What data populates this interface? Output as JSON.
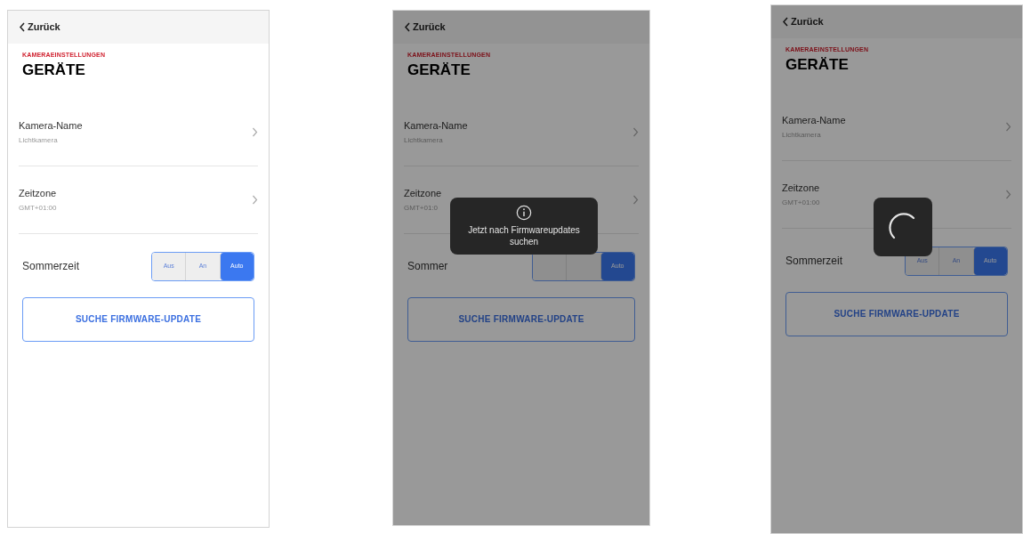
{
  "screens": [
    {
      "back": "Zurück",
      "overline": "KAMERAEINSTELLUNGEN",
      "title": "GERÄTE",
      "rows": [
        {
          "label": "Kamera-Name",
          "value": "Lichtkamera"
        },
        {
          "label": "Zeitzone",
          "value": "GMT+01:00"
        }
      ],
      "toggle": {
        "label": "Sommerzeit",
        "options": [
          {
            "label": "Aus",
            "selected": false
          },
          {
            "label": "An",
            "selected": false
          },
          {
            "label": "Auto",
            "selected": true
          }
        ]
      },
      "button": "SUCHE FIRMWARE-UPDATE",
      "dimmed": false
    },
    {
      "back": "Zurück",
      "overline": "KAMERAEINSTELLUNGEN",
      "title": "GERÄTE",
      "rows": [
        {
          "label": "Kamera-Name",
          "value": "Lichtkamera"
        },
        {
          "label": "Zeitzone",
          "value": "GMT+01:0"
        }
      ],
      "toggle": {
        "label": "Sommer",
        "options": [
          {
            "selected": false
          },
          {
            "selected": false
          },
          {
            "label": "Auto",
            "selected": true
          }
        ]
      },
      "button": "SUCHE FIRMWARE-UPDATE",
      "dimmed": true,
      "overlay": {
        "kind": "toast",
        "message": "Jetzt nach Firmwareupdates suchen"
      }
    },
    {
      "back": "Zurück",
      "overline": "KAMERAEINSTELLUNGEN",
      "title": "GERÄTE",
      "rows": [
        {
          "label": "Kamera-Name",
          "value": "Lichtkamera"
        },
        {
          "label": "Zeitzone",
          "value": "GMT+01:00"
        }
      ],
      "toggle": {
        "label": "Sommerzeit",
        "options": [
          {
            "label": "Aus",
            "selected": false
          },
          {
            "label": "An",
            "selected": false
          },
          {
            "label": "Auto",
            "selected": true
          }
        ]
      },
      "button": "SUCHE FIRMWARE-UPDATE",
      "dimmed": true,
      "overlay": {
        "kind": "spinner"
      }
    }
  ]
}
